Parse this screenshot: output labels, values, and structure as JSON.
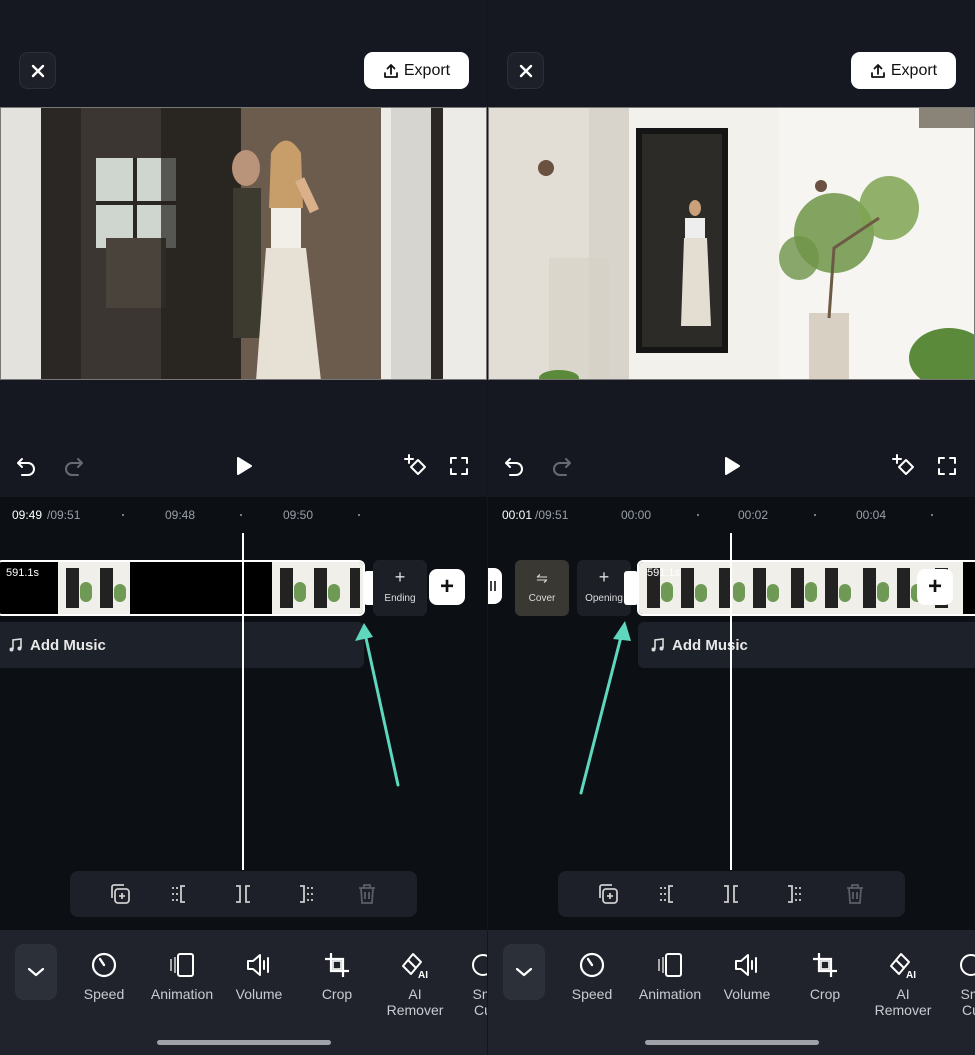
{
  "left": {
    "export_label": "Export",
    "timecode_current": "09:49",
    "timecode_total": "/09:51",
    "ticks": [
      "09:48",
      "09:50"
    ],
    "clip_duration": "591.1s",
    "ending_label": "Ending",
    "add_music_label": "Add Music"
  },
  "right": {
    "export_label": "Export",
    "timecode_current": "00:01",
    "timecode_total": "/09:51",
    "ticks": [
      "00:00",
      "00:02",
      "00:04"
    ],
    "clip_duration": "591.1s",
    "cover_label": "Cover",
    "opening_label": "Opening",
    "add_music_label": "Add Music"
  },
  "bottom_tools": {
    "speed": "Speed",
    "animation": "Animation",
    "volume": "Volume",
    "crop": "Crop",
    "ai_remover": "AI\nRemover",
    "smart_cut": "Sm\nCu"
  },
  "colors": {
    "background": "#151820",
    "timeline_bg": "#0c0f14",
    "accent_arrow": "#5ed7bd",
    "export_bg": "#ffffff"
  }
}
